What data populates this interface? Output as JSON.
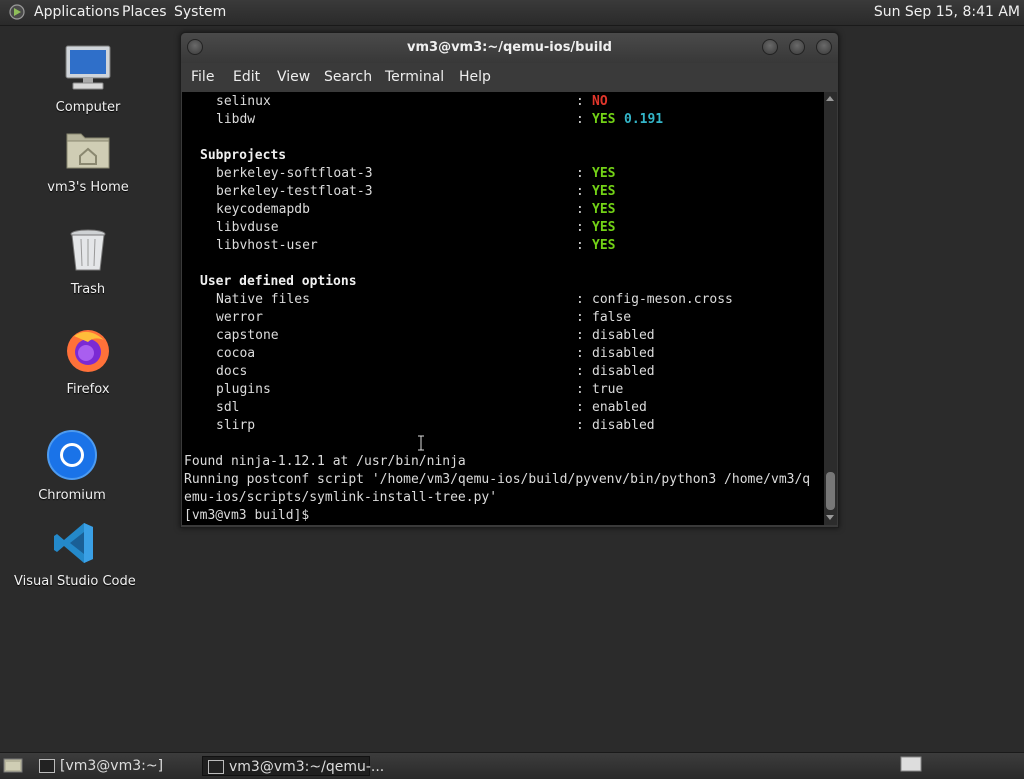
{
  "top_panel": {
    "menu": [
      "Applications",
      "Places",
      "System"
    ],
    "clock": "Sun Sep 15,  8:41 AM"
  },
  "desktop_icons": [
    {
      "label": "Computer"
    },
    {
      "label": "vm3's Home"
    },
    {
      "label": "Trash"
    },
    {
      "label": "Firefox"
    },
    {
      "label": "Chromium"
    },
    {
      "label": "Visual Studio Code"
    }
  ],
  "window": {
    "title": "vm3@vm3:~/qemu-ios/build",
    "menu": [
      "File",
      "Edit",
      "View",
      "Search",
      "Terminal",
      "Help"
    ]
  },
  "terminal": {
    "top_rows": [
      {
        "key": "selinux",
        "value": "NO",
        "status": "no",
        "extra": ""
      },
      {
        "key": "libdw",
        "value": "YES",
        "status": "yes",
        "extra": "0.191"
      }
    ],
    "subprojects_header": "Subprojects",
    "subprojects": [
      {
        "key": "berkeley-softfloat-3",
        "value": "YES"
      },
      {
        "key": "berkeley-testfloat-3",
        "value": "YES"
      },
      {
        "key": "keycodemapdb",
        "value": "YES"
      },
      {
        "key": "libvduse",
        "value": "YES"
      },
      {
        "key": "libvhost-user",
        "value": "YES"
      }
    ],
    "options_header": "User defined options",
    "options": [
      {
        "key": "Native files",
        "value": "config-meson.cross"
      },
      {
        "key": "werror",
        "value": "false"
      },
      {
        "key": "capstone",
        "value": "disabled"
      },
      {
        "key": "cocoa",
        "value": "disabled"
      },
      {
        "key": "docs",
        "value": "disabled"
      },
      {
        "key": "plugins",
        "value": "true"
      },
      {
        "key": "sdl",
        "value": "enabled"
      },
      {
        "key": "slirp",
        "value": "disabled"
      }
    ],
    "output_lines": [
      "Found ninja-1.12.1 at /usr/bin/ninja",
      "Running postconf script '/home/vm3/qemu-ios/build/pyvenv/bin/python3 /home/vm3/q",
      "emu-ios/scripts/symlink-install-tree.py'",
      "[vm3@vm3 build]$ "
    ],
    "separator": ":"
  },
  "taskbar": {
    "tasks": [
      {
        "label": "[vm3@vm3:~]"
      },
      {
        "label": "vm3@vm3:~/qemu-..."
      }
    ]
  }
}
